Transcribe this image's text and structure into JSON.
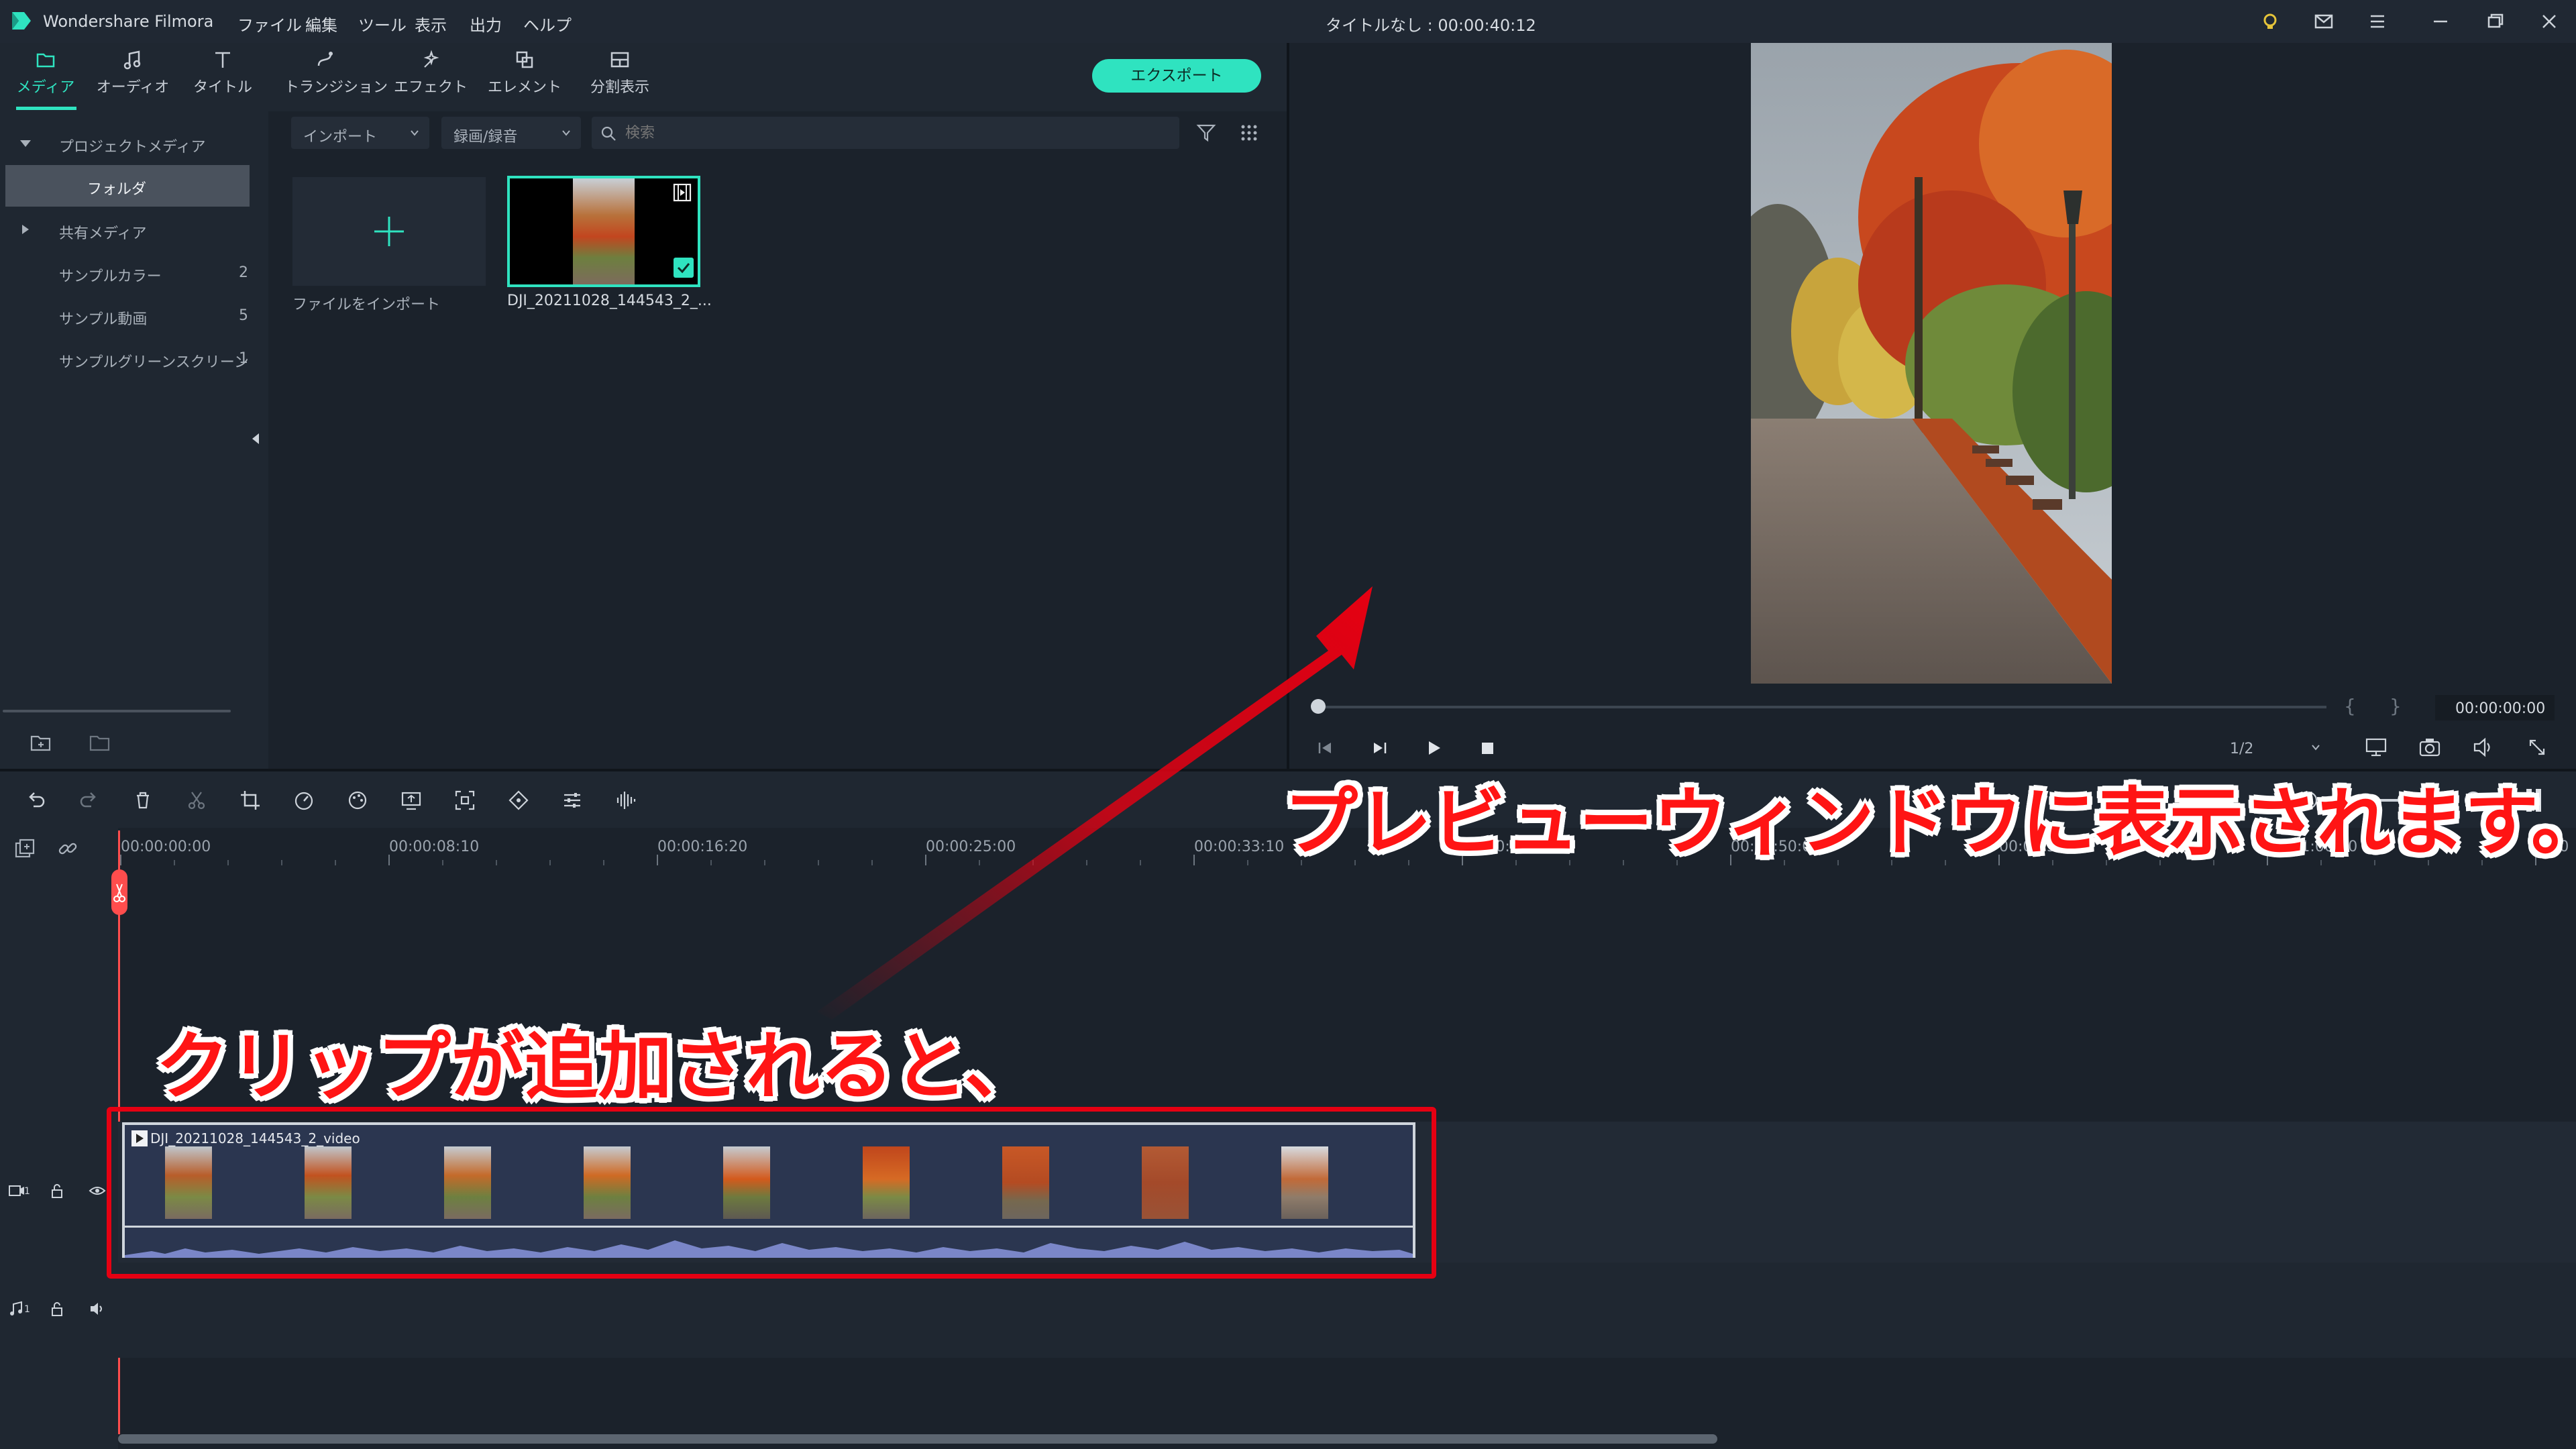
{
  "app": {
    "name": "Wondershare Filmora",
    "doc_title": "タイトルなし : 00:00:40:12"
  },
  "menu": [
    "ファイル",
    "編集",
    "ツール",
    "表示",
    "出力",
    "ヘルプ"
  ],
  "tabs": [
    {
      "label": "メディア",
      "icon": "folder-icon"
    },
    {
      "label": "オーディオ",
      "icon": "music-note-icon"
    },
    {
      "label": "タイトル",
      "icon": "text-t-icon"
    },
    {
      "label": "トランジション",
      "icon": "transition-icon"
    },
    {
      "label": "エフェクト",
      "icon": "effect-icon"
    },
    {
      "label": "エレメント",
      "icon": "element-icon"
    },
    {
      "label": "分割表示",
      "icon": "split-screen-icon"
    }
  ],
  "export_label": "エクスポート",
  "library": {
    "project_media": "プロジェクトメディア",
    "folder": "フォルダ",
    "shared_media": "共有メディア",
    "items": [
      {
        "label": "サンプルカラー",
        "count": "2"
      },
      {
        "label": "サンプル動画",
        "count": "5"
      },
      {
        "label": "サンプルグリーンスクリーン",
        "count": "1"
      }
    ]
  },
  "media_toolbar": {
    "import": "インポート",
    "record": "録画/録音",
    "search_placeholder": "検索"
  },
  "media_items": {
    "import_label": "ファイルをインポート",
    "clip_name": "DJI_20211028_144543_2_..."
  },
  "preview": {
    "timecode": "00:00:00:00",
    "quality": "1/2"
  },
  "ruler": [
    "00:00:00:00",
    "00:00:08:10",
    "00:00:16:20",
    "00:00:25:00",
    "00:00:33:10",
    "00:00:41:20",
    "00:00:50:00",
    "00:00:58:10",
    "00:01:06:20",
    "00:0"
  ],
  "tracks": {
    "video_num": "1",
    "audio_num": "1"
  },
  "clip": {
    "label": "DJI_20211028_144543_2_video"
  },
  "annotations": {
    "preview_note": "プレビューウィンドウに表示されます。",
    "clip_note": "クリップが追加されると、"
  },
  "colors": {
    "accent": "#2fe3c0",
    "playhead": "#ff4d4d",
    "annotation": "#e60012"
  }
}
